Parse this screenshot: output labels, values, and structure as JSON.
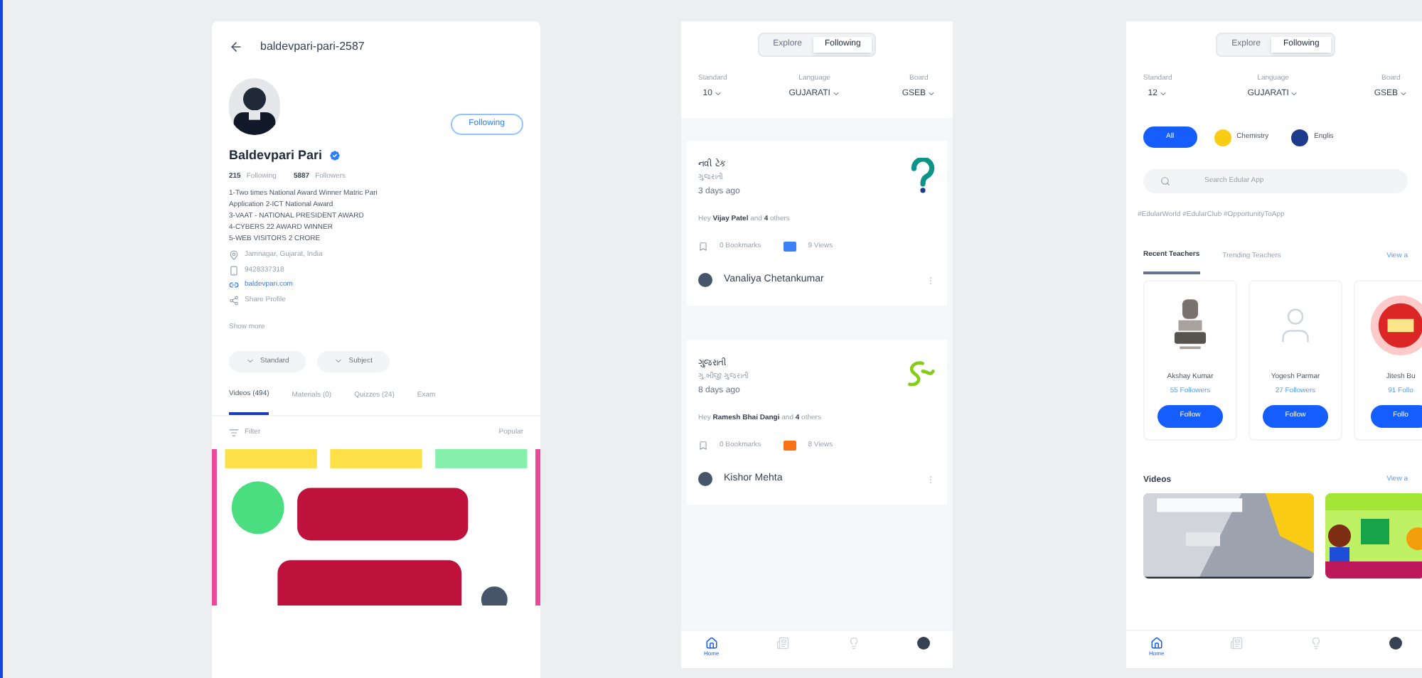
{
  "left_phone": {
    "title": "baldevpari-pari-2587",
    "follow_button": "Following",
    "name": "Baldevpari Pari",
    "verified": true,
    "stats": [
      {
        "value": "215",
        "label": "Following"
      },
      {
        "value": "5887",
        "label": "Followers"
      }
    ],
    "bio": [
      "1-Two times National Award Winner Matric Pari",
      "Application 2-ICT National Award",
      "3-VAAT - NATIONAL PRESIDENT AWARD",
      "4-CYBERS 22 AWARD WINNER",
      "5-WEB VISITORS 2 CRORE"
    ],
    "details": [
      {
        "kind": "location",
        "text": "Jamnagar, Gujarat, India"
      },
      {
        "kind": "phone",
        "text": "9428337318"
      },
      {
        "kind": "link",
        "text": "baldevpari.com"
      },
      {
        "kind": "share",
        "text": "Share Profile"
      }
    ],
    "show_more": "Show more",
    "chips": [
      "Standard",
      "Subject"
    ],
    "tabs": [
      {
        "label": "Videos (494)",
        "selected": true
      },
      {
        "label": "Materials (0)",
        "selected": false
      },
      {
        "label": "Quizzes (24)",
        "selected": false
      },
      {
        "label": "Exam",
        "selected": false
      }
    ],
    "filter": "Filter",
    "sort": "Popular"
  },
  "middle_phone": {
    "segments": [
      {
        "label": "Explore",
        "selected": false
      },
      {
        "label": "Following",
        "selected": true
      }
    ],
    "filters": [
      {
        "label": "Standard",
        "value": "10"
      },
      {
        "label": "Language",
        "value": "GUJARATI"
      },
      {
        "label": "Board",
        "value": "GSEB"
      }
    ],
    "posts": [
      {
        "title": "નવી ટેક",
        "subtitle": "ગુજરાતી",
        "time": "3 days ago",
        "liked_by": "Hey **Vijay Patel** and **4** others",
        "bookmarks": "0 Bookmarks",
        "views": "9 Views",
        "color": "#3b82f6",
        "author": "Vanaliya Chetankumar"
      },
      {
        "title": "ગુજરાતી",
        "subtitle": "ગુ.બીજી ગુજરાતી",
        "time": "8 days ago",
        "liked_by": "Hey **Ramesh Bhai Dangi** and **4** others",
        "bookmarks": "0 Bookmarks",
        "views": "8 Views",
        "color": "#f97316",
        "author": "Kishor Mehta"
      }
    ],
    "nav": [
      {
        "label": "Home",
        "selected": true
      },
      {
        "selected": false
      },
      {
        "selected": false
      },
      {
        "selected": false
      }
    ]
  },
  "right_phone": {
    "segments": [
      {
        "label": "Explore",
        "selected": false
      },
      {
        "label": "Following",
        "selected": true
      }
    ],
    "filters": [
      {
        "label": "Standard",
        "value": "12"
      },
      {
        "label": "Language",
        "value": "GUJARATI"
      },
      {
        "label": "Board",
        "value": "GSEB"
      }
    ],
    "subjects": [
      {
        "label": "All",
        "selected": true
      },
      {
        "label": "Chemistry",
        "selected": false,
        "color": "#facc15"
      },
      {
        "label": "Englis",
        "selected": false,
        "color": "#1e3a8a"
      }
    ],
    "search": {
      "placeholder": "Search Edular App"
    },
    "hashtags": "#EdularWorld #EdularClub #OpportunityToApp",
    "tabs": [
      {
        "label": "Recent Teachers",
        "selected": true
      },
      {
        "label": "Trending Teachers",
        "selected": false
      }
    ],
    "view_all": "View a",
    "teachers": [
      {
        "photo": true,
        "name": "Akshay Kumar",
        "followers": "55 Followers",
        "button": "Follow"
      },
      {
        "photo": false,
        "name": "Yogesh Parmar",
        "followers": "27 Followers",
        "button": "Follow"
      },
      {
        "photo": true,
        "name": "Jitesh Bu",
        "followers": "91 Follo",
        "button": "Follo"
      }
    ],
    "videos_title": "Videos",
    "videos_view_all": "View a",
    "nav": [
      {
        "label": "Home",
        "selected": true
      },
      {
        "selected": false
      },
      {
        "selected": false
      },
      {
        "selected": false
      }
    ]
  }
}
